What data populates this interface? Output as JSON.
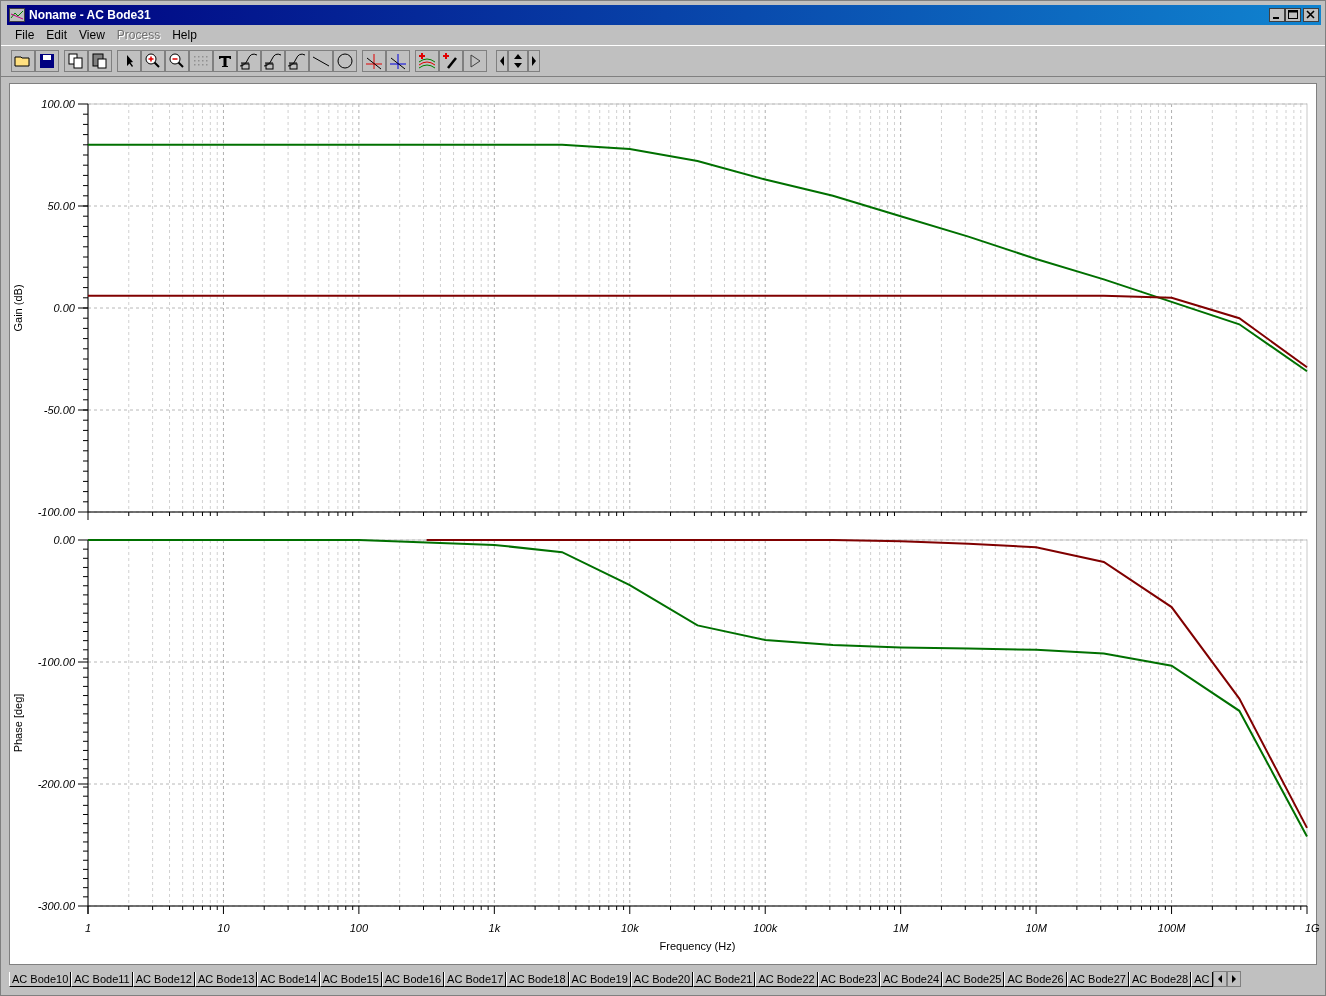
{
  "window": {
    "title": "Noname - AC Bode31"
  },
  "menu": [
    {
      "label": "File",
      "disabled": false
    },
    {
      "label": "Edit",
      "disabled": false
    },
    {
      "label": "View",
      "disabled": false
    },
    {
      "label": "Process",
      "disabled": true
    },
    {
      "label": "Help",
      "disabled": false
    }
  ],
  "gain_plot": {
    "chart_data": {
      "type": "line",
      "grid": true,
      "ylabel": "Gain (dB)",
      "categories": [
        null,
        null,
        null,
        null,
        null,
        null,
        null,
        null,
        null,
        null,
        null,
        null,
        null,
        null,
        null,
        null,
        null,
        null,
        null
      ],
      "series": [
        {
          "color": "#007000",
          "values": [
            80,
            80,
            80,
            80,
            80,
            80,
            80,
            80,
            78,
            72,
            63,
            55,
            45,
            35,
            24,
            14,
            3,
            -8,
            -31
          ]
        },
        {
          "color": "#800000",
          "values": [
            6,
            6,
            6,
            6,
            6,
            6,
            6,
            6,
            6,
            6,
            6,
            6,
            6,
            6,
            6,
            6,
            5,
            -5,
            -29
          ]
        }
      ],
      "ylim": [
        -100,
        100
      ],
      "yticks": [
        {
          "value": 100,
          "label": "100.00"
        },
        {
          "value": 50,
          "label": "50.00"
        },
        {
          "value": 0,
          "label": "0.00"
        },
        {
          "value": -50,
          "label": "-50.00"
        },
        {
          "value": -100,
          "label": "-100.00"
        }
      ]
    }
  },
  "phase_plot": {
    "chart_data": {
      "type": "line",
      "grid": true,
      "xlabel": "Frequency (Hz)",
      "ylabel": "Phase [deg]",
      "categories": [
        "1",
        null,
        "10",
        null,
        "100",
        null,
        "1k",
        null,
        "10k",
        null,
        "100k",
        null,
        "1M",
        null,
        "10M",
        null,
        "100M",
        null,
        "1G"
      ],
      "series": [
        {
          "color": "#007000",
          "values": [
            0,
            0,
            0,
            0,
            0,
            -2,
            -4,
            -10,
            -37,
            -70,
            -82,
            -86,
            -88,
            -89,
            -90,
            -93,
            -103,
            -140,
            -243
          ]
        },
        {
          "color": "#800000",
          "values": [
            null,
            null,
            null,
            null,
            null,
            0,
            0,
            0,
            0,
            0,
            0,
            0,
            -1,
            -3,
            -6,
            -18,
            -55,
            -130,
            -236
          ]
        }
      ],
      "ylim": [
        -300,
        0
      ],
      "yticks": [
        {
          "value": 0,
          "label": "0.00"
        },
        {
          "value": -100,
          "label": "-100.00"
        },
        {
          "value": -200,
          "label": "-200.00"
        },
        {
          "value": -300,
          "label": "-300.00"
        }
      ]
    }
  },
  "tabs": [
    {
      "label": "AC Bode10",
      "selected": false
    },
    {
      "label": "AC Bode11",
      "selected": false
    },
    {
      "label": "AC Bode12",
      "selected": false
    },
    {
      "label": "AC Bode13",
      "selected": false
    },
    {
      "label": "AC Bode14",
      "selected": false
    },
    {
      "label": "AC Bode15",
      "selected": false
    },
    {
      "label": "AC Bode16",
      "selected": false
    },
    {
      "label": "AC Bode17",
      "selected": false
    },
    {
      "label": "AC Bode18",
      "selected": false
    },
    {
      "label": "AC Bode19",
      "selected": false
    },
    {
      "label": "AC Bode20",
      "selected": false
    },
    {
      "label": "AC Bode21",
      "selected": false
    },
    {
      "label": "AC Bode22",
      "selected": false
    },
    {
      "label": "AC Bode23",
      "selected": false
    },
    {
      "label": "AC Bode24",
      "selected": false
    },
    {
      "label": "AC Bode25",
      "selected": false
    },
    {
      "label": "AC Bode26",
      "selected": false
    },
    {
      "label": "AC Bode27",
      "selected": false
    },
    {
      "label": "AC Bode28",
      "selected": false
    },
    {
      "label": "AC",
      "selected": false
    }
  ]
}
